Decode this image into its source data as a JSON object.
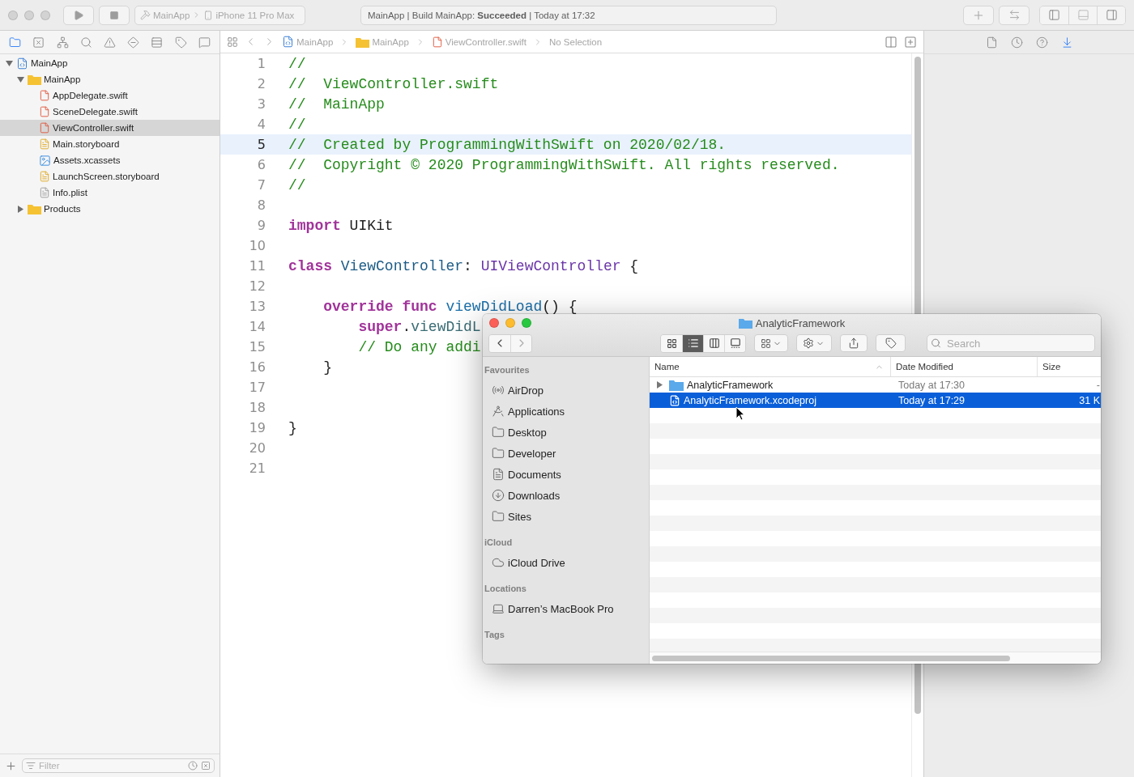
{
  "toolbar": {
    "scheme": {
      "app": "MainApp",
      "device": "iPhone 11 Pro Max"
    },
    "activity": "MainApp | Build MainApp: **Succeeded** | Today at 17:32",
    "panel_toggles": [
      {
        "kind": "navigator",
        "on": true
      },
      {
        "kind": "debug",
        "on": false
      },
      {
        "kind": "inspector",
        "on": true
      }
    ]
  },
  "navigator": {
    "tabs": [
      {
        "kind": "folder",
        "selected": true
      },
      {
        "kind": "source",
        "selected": false
      },
      {
        "kind": "symbols",
        "selected": false
      },
      {
        "kind": "find",
        "selected": false
      },
      {
        "kind": "issues",
        "selected": false
      },
      {
        "kind": "tests",
        "selected": false
      },
      {
        "kind": "debug",
        "selected": false
      },
      {
        "kind": "breakpoints",
        "selected": false
      },
      {
        "kind": "reports",
        "selected": false
      }
    ],
    "tree": [
      {
        "label": "MainApp",
        "kind": "project",
        "expanded": true,
        "selected": false,
        "children": [
          {
            "label": "MainApp",
            "kind": "folder",
            "expanded": true,
            "selected": false,
            "children": [
              {
                "label": "AppDelegate.swift",
                "kind": "swift",
                "selected": false
              },
              {
                "label": "SceneDelegate.swift",
                "kind": "swift",
                "selected": false
              },
              {
                "label": "ViewController.swift",
                "kind": "swift",
                "selected": true
              },
              {
                "label": "Main.storyboard",
                "kind": "storyboard",
                "selected": false
              },
              {
                "label": "Assets.xcassets",
                "kind": "assets",
                "selected": false
              },
              {
                "label": "LaunchScreen.storyboard",
                "kind": "storyboard",
                "selected": false
              },
              {
                "label": "Info.plist",
                "kind": "plist",
                "selected": false
              }
            ]
          },
          {
            "label": "Products",
            "kind": "folder",
            "expanded": false,
            "selected": false
          }
        ]
      }
    ],
    "filter": {
      "placeholder": "Filter"
    }
  },
  "jump_bar": {
    "path": [
      {
        "label": "MainApp",
        "kind": "project"
      },
      {
        "label": "MainApp",
        "kind": "folder"
      },
      {
        "label": "ViewController.swift",
        "kind": "swift"
      },
      {
        "label": "No Selection",
        "kind": "none"
      }
    ]
  },
  "editor": {
    "lines": [
      {
        "number": "1",
        "selected": false,
        "tokens": [
          {
            "kind": "comment",
            "text": "//"
          }
        ]
      },
      {
        "number": "2",
        "selected": false,
        "tokens": [
          {
            "kind": "comment",
            "text": "//  ViewController.swift"
          }
        ]
      },
      {
        "number": "3",
        "selected": false,
        "tokens": [
          {
            "kind": "comment",
            "text": "//  MainApp"
          }
        ]
      },
      {
        "number": "4",
        "selected": false,
        "tokens": [
          {
            "kind": "comment",
            "text": "//"
          }
        ]
      },
      {
        "number": "5",
        "selected": true,
        "tokens": [
          {
            "kind": "comment",
            "text": "//  Created by ProgrammingWithSwift on 2020/02/18."
          }
        ]
      },
      {
        "number": "6",
        "selected": false,
        "tokens": [
          {
            "kind": "comment",
            "text": "//  Copyright © 2020 ProgrammingWithSwift. All rights reserved."
          }
        ]
      },
      {
        "number": "7",
        "selected": false,
        "tokens": [
          {
            "kind": "comment",
            "text": "//"
          }
        ]
      },
      {
        "number": "8",
        "selected": false
      },
      {
        "number": "9",
        "selected": false,
        "tokens": [
          {
            "kind": "keyword",
            "text": "import"
          },
          {
            "kind": "plain",
            "text": " UIKit"
          }
        ]
      },
      {
        "number": "10",
        "selected": false
      },
      {
        "number": "11",
        "selected": false,
        "tokens": [
          {
            "kind": "keyword",
            "text": "class"
          },
          {
            "kind": "declaration",
            "text": " ViewController"
          },
          {
            "kind": "plain",
            "text": ": "
          },
          {
            "kind": "type",
            "text": "UIViewController"
          },
          {
            "kind": "plain",
            "text": " {"
          }
        ]
      },
      {
        "number": "12",
        "selected": false
      },
      {
        "number": "13",
        "selected": false,
        "tokens": [
          {
            "kind": "keyword",
            "text": "    override func"
          },
          {
            "kind": "function",
            "text": " viewDidLoad"
          },
          {
            "kind": "plain",
            "text": "() {"
          }
        ]
      },
      {
        "number": "14",
        "selected": false,
        "tokens": [
          {
            "kind": "keyword",
            "text": "        super"
          },
          {
            "kind": "plain",
            "text": "."
          },
          {
            "kind": "method",
            "text": "viewDidL"
          }
        ]
      },
      {
        "number": "15",
        "selected": false,
        "tokens": [
          {
            "kind": "comment",
            "text": "        // Do any addi"
          }
        ]
      },
      {
        "number": "16",
        "selected": false,
        "tokens": [
          {
            "kind": "plain",
            "text": "    }"
          }
        ]
      },
      {
        "number": "17",
        "selected": false
      },
      {
        "number": "18",
        "selected": false
      },
      {
        "number": "19",
        "selected": false,
        "tokens": [
          {
            "kind": "plain",
            "text": "}"
          }
        ]
      },
      {
        "number": "20",
        "selected": false
      },
      {
        "number": "21",
        "selected": false
      }
    ]
  },
  "inspector": {
    "tabs": [
      {
        "kind": "file",
        "selected": false
      },
      {
        "kind": "history",
        "selected": false
      },
      {
        "kind": "help",
        "selected": false
      },
      {
        "kind": "attributes",
        "selected": true
      }
    ]
  },
  "finder": {
    "title": "AnalyticFramework",
    "view_modes": [
      {
        "kind": "icons",
        "selected": false
      },
      {
        "kind": "list",
        "selected": true
      },
      {
        "kind": "columns",
        "selected": false
      },
      {
        "kind": "gallery",
        "selected": false
      }
    ],
    "search": {
      "placeholder": "Search"
    },
    "sidebar": [
      {
        "title": "Favourites",
        "items": [
          {
            "label": "AirDrop",
            "kind": "airdrop"
          },
          {
            "label": "Applications",
            "kind": "apps"
          },
          {
            "label": "Desktop",
            "kind": "folder"
          },
          {
            "label": "Developer",
            "kind": "folder"
          },
          {
            "label": "Documents",
            "kind": "document"
          },
          {
            "label": "Downloads",
            "kind": "download"
          },
          {
            "label": "Sites",
            "kind": "folder"
          }
        ]
      },
      {
        "title": "iCloud",
        "items": [
          {
            "label": "iCloud Drive",
            "kind": "cloud"
          }
        ]
      },
      {
        "title": "Locations",
        "items": [
          {
            "label": "Darren’s MacBook Pro",
            "kind": "laptop"
          }
        ]
      },
      {
        "title": "Tags"
      }
    ],
    "columns": [
      "Name",
      "Date Modified",
      "Size"
    ],
    "rows": [
      {
        "name": "AnalyticFramework",
        "kind": "folder",
        "expanded": false,
        "date": "Today at 17:30",
        "size": "-",
        "selected": false
      },
      {
        "name": "AnalyticFramework.xcodeproj",
        "kind": "project",
        "date": "Today at 17:29",
        "size": "31 K",
        "selected": true
      }
    ]
  }
}
